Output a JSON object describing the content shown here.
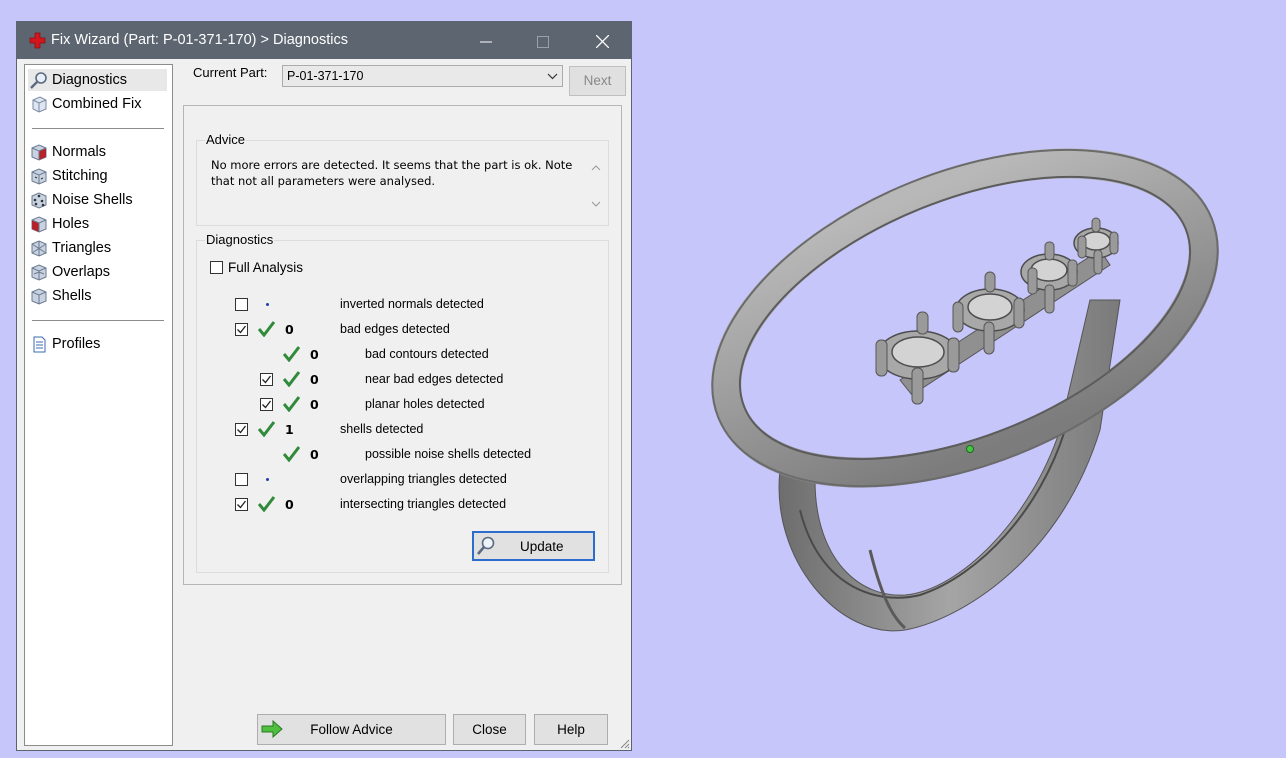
{
  "window": {
    "title": "Fix Wizard (Part: P-01-371-170) > Diagnostics",
    "colors": {
      "titlebar": "#5d6570",
      "viewport_background": "#c6c6fb",
      "check_green": "#2f8a3a"
    }
  },
  "sidebar": {
    "items": [
      {
        "label": "Diagnostics",
        "icon": "magnifier-icon",
        "selected": true
      },
      {
        "label": "Combined Fix",
        "icon": "cube-icon"
      },
      {
        "label": "Normals",
        "icon": "cube-red-face-icon"
      },
      {
        "label": "Stitching",
        "icon": "cube-stitch-icon"
      },
      {
        "label": "Noise Shells",
        "icon": "dotted-cube-icon"
      },
      {
        "label": "Holes",
        "icon": "cube-hole-icon"
      },
      {
        "label": "Triangles",
        "icon": "triangle-cube-icon"
      },
      {
        "label": "Overlaps",
        "icon": "overlap-cube-icon"
      },
      {
        "label": "Shells",
        "icon": "shell-cube-icon"
      },
      {
        "label": "Profiles",
        "icon": "document-icon"
      }
    ]
  },
  "header": {
    "current_part_label": "Current Part:",
    "current_part_value": "P-01-371-170",
    "next_label": "Next"
  },
  "advice": {
    "title": "Advice",
    "text_line1": "No more errors are detected. It seems that the part is ok. Note",
    "text_line2": "that not all parameters were analysed."
  },
  "diagnostics": {
    "title": "Diagnostics",
    "full_analysis_label": "Full Analysis",
    "full_analysis_checked": false,
    "rows": [
      {
        "checked": false,
        "status": "dot",
        "count": "",
        "label": "inverted normals detected"
      },
      {
        "checked": true,
        "status": "ok",
        "count": "0",
        "label": "bad edges detected"
      },
      {
        "checked": null,
        "status": "ok",
        "count": "0",
        "label": "bad contours detected"
      },
      {
        "checked": true,
        "status": "ok",
        "count": "0",
        "label": "near bad edges detected"
      },
      {
        "checked": true,
        "status": "ok",
        "count": "0",
        "label": "planar holes detected"
      },
      {
        "checked": true,
        "status": "ok",
        "count": "1",
        "label": "shells detected"
      },
      {
        "checked": null,
        "status": "ok",
        "count": "0",
        "label": "possible noise shells detected"
      },
      {
        "checked": false,
        "status": "dot",
        "count": "",
        "label": "overlapping triangles detected"
      },
      {
        "checked": true,
        "status": "ok",
        "count": "0",
        "label": "intersecting triangles detected"
      }
    ],
    "update_label": "Update"
  },
  "footer": {
    "follow_advice_label": "Follow Advice",
    "close_label": "Close",
    "help_label": "Help"
  }
}
